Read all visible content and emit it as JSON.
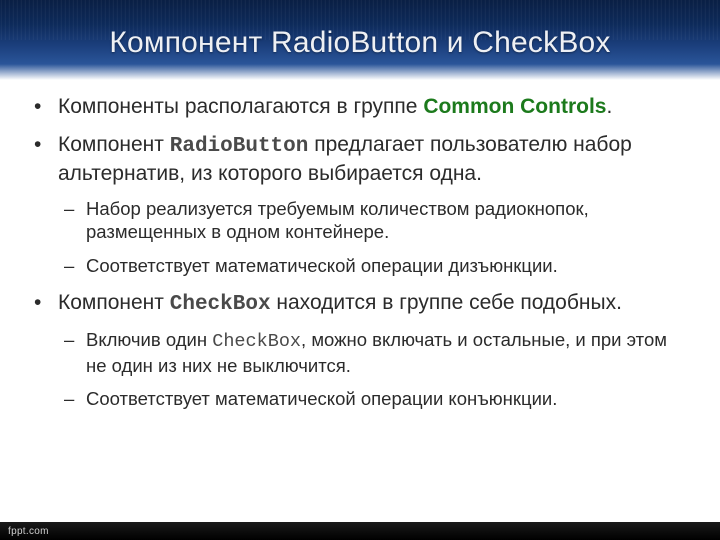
{
  "title": "Компонент RadioButton и CheckBox",
  "bullets": {
    "b1_a": "Компоненты располагаются в группе ",
    "b1_hl": "Common Controls",
    "b1_b": ".",
    "b2_a": "Компонент ",
    "b2_hl": "RadioButton",
    "b2_b": " предлагает пользователю набор альтернатив, из которого выбирается одна.",
    "b2_s1": "Набор реализуется требуемым количеством радиокнопок, размещенных в одном контейнере.",
    "b2_s2": "Соответствует математической операции дизъюнкции.",
    "b3_a": "Компонент ",
    "b3_hl": "CheckBox",
    "b3_b": " находится в группе себе подобных.",
    "b3_s1_a": "Включив один ",
    "b3_s1_hl": "CheckBox",
    "b3_s1_b": ", можно включать и остальные, и при этом не один из них не выключится.",
    "b3_s2": "Соответствует математической операции конъюнкции."
  },
  "footer": "fppt.com"
}
